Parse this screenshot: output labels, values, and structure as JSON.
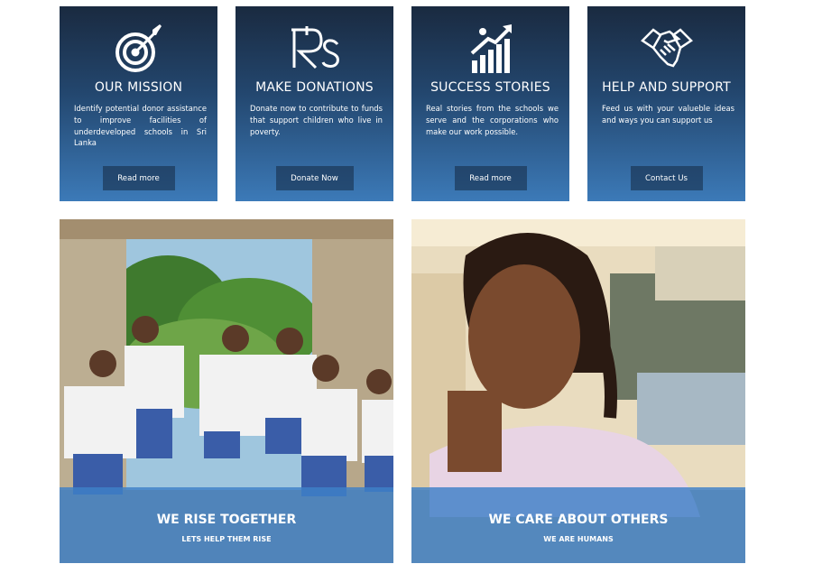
{
  "cards": [
    {
      "icon": "target-icon",
      "title": "OUR MISSION",
      "text": "Identify potential donor assistance to improve facilities of underdeveloped schools in Sri Lanka",
      "button": "Read more"
    },
    {
      "icon": "rupee-icon",
      "title": "MAKE DONATIONS",
      "text": "Donate now to contribute to funds that support children who live in poverty.",
      "button": "Donate Now"
    },
    {
      "icon": "growth-chart-icon",
      "title": "SUCCESS STORIES",
      "text": "Real stories from the schools we serve and the corporations who make our work possible.",
      "button": "Read more"
    },
    {
      "icon": "handshake-icon",
      "title": "HELP AND SUPPORT",
      "text": "Feed us with your valueble ideas and ways you can support us",
      "button": "Contact Us"
    }
  ],
  "banners": [
    {
      "title": "WE RISE TOGETHER",
      "subtitle": "LETS HELP THEM RISE"
    },
    {
      "title": "WE CARE ABOUT OTHERS",
      "subtitle": "WE ARE HUMANS"
    }
  ]
}
